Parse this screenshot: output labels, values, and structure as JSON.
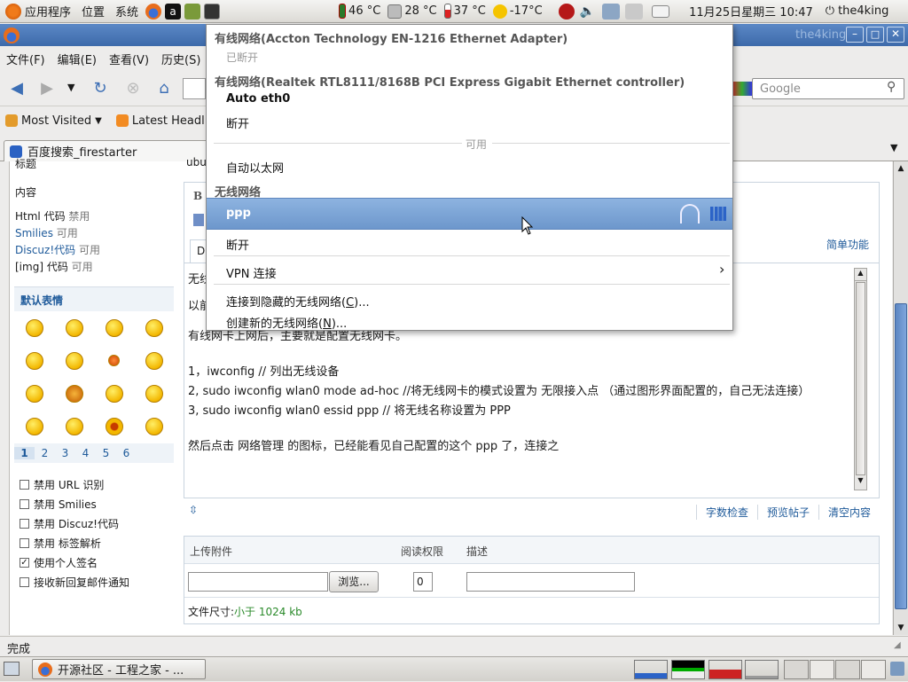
{
  "top_panel": {
    "apps": "应用程序",
    "places": "位置",
    "system": "系统",
    "temps": [
      "46 °C",
      "28 °C",
      "37 °C",
      "-17°C"
    ],
    "clock": "11月25日星期三 10:47",
    "user": "the4king"
  },
  "window": {
    "title": "the4king"
  },
  "menubar": {
    "items": [
      "文件(F)",
      "编辑(E)",
      "查看(V)",
      "历史(S)"
    ]
  },
  "navbar": {
    "search_placeholder": "Google"
  },
  "bookmarks": {
    "items": [
      "Most Visited",
      "Latest Headl"
    ]
  },
  "tabs": [
    {
      "label": "百度搜索_firestarter"
    }
  ],
  "sidebar": {
    "partial_top": "标题",
    "partial_top2": "ubu",
    "content_label": "内容",
    "html_code": "Html 代码",
    "html_status": "禁用",
    "smilies": "Smilies",
    "smilies_status": "可用",
    "discuz": "Discuz!代码",
    "discuz_status": "可用",
    "img": "[img] 代码",
    "img_status": "可用",
    "smiley_title": "默认表情",
    "pages": [
      "1",
      "2",
      "3",
      "4",
      "5",
      "6"
    ],
    "checkboxes": [
      {
        "label": "禁用 URL 识别",
        "checked": false
      },
      {
        "label": "禁用 Smilies",
        "checked": false
      },
      {
        "label": "禁用 Discuz!代码",
        "checked": false
      },
      {
        "label": "禁用 标签解析",
        "checked": false
      },
      {
        "label": "使用个人签名",
        "checked": true
      },
      {
        "label": "接收新回复邮件通知",
        "checked": false
      }
    ]
  },
  "editor": {
    "simple_mode": "简单功能",
    "partial_lines": [
      "无线",
      "以前"
    ],
    "lines": [
      "有线网卡上网后，主要就是配置无线网卡。",
      "1，iwconfig   // 列出无线设备",
      "2, sudo iwconfig wlan0 mode ad-hoc    //将无线网卡的模式设置为 无限接入点 （通过图形界面配置的，自己无法连接）",
      "3, sudo iwconfig wlan0 essid ppp     // 将无线名称设置为 PPP",
      "然后点击 网络管理 的图标，已经能看见自己配置的这个 ppp 了，连接之"
    ],
    "footer": [
      "字数检查",
      "预览帖子",
      "清空内容"
    ]
  },
  "attachments": {
    "col_upload": "上传附件",
    "col_perm": "阅读权限",
    "col_desc": "描述",
    "browse": "浏览...",
    "perm_value": "0",
    "size_label": "文件尺寸:",
    "size_value": "小于 1024 kb"
  },
  "statusbar": {
    "text": "完成"
  },
  "taskbar": {
    "task": "开源社区 - 工程之家 - ..."
  },
  "network_menu": {
    "wired1_title": "有线网络(Accton Technology EN-1216 Ethernet Adapter)",
    "wired1_status": "已断开",
    "wired2_title": "有线网络(Realtek RTL8111/8168B PCI Express Gigabit Ethernet controller)",
    "wired2_conn": "Auto eth0",
    "wired2_disconnect": "断开",
    "available": "可用",
    "auto_ethernet": "自动以太网",
    "wireless_title": "无线网络",
    "ppp": "ppp",
    "wireless_disconnect": "断开",
    "vpn": "VPN 连接",
    "hidden_pre": "连接到隐藏的无线网络(",
    "hidden_key": "C",
    "hidden_post": ")...",
    "new_pre": "创建新的无线网络(",
    "new_key": "N",
    "new_post": ")..."
  },
  "colors": {
    "highlight": "#7aa3d6",
    "link": "#1e5a9a"
  }
}
